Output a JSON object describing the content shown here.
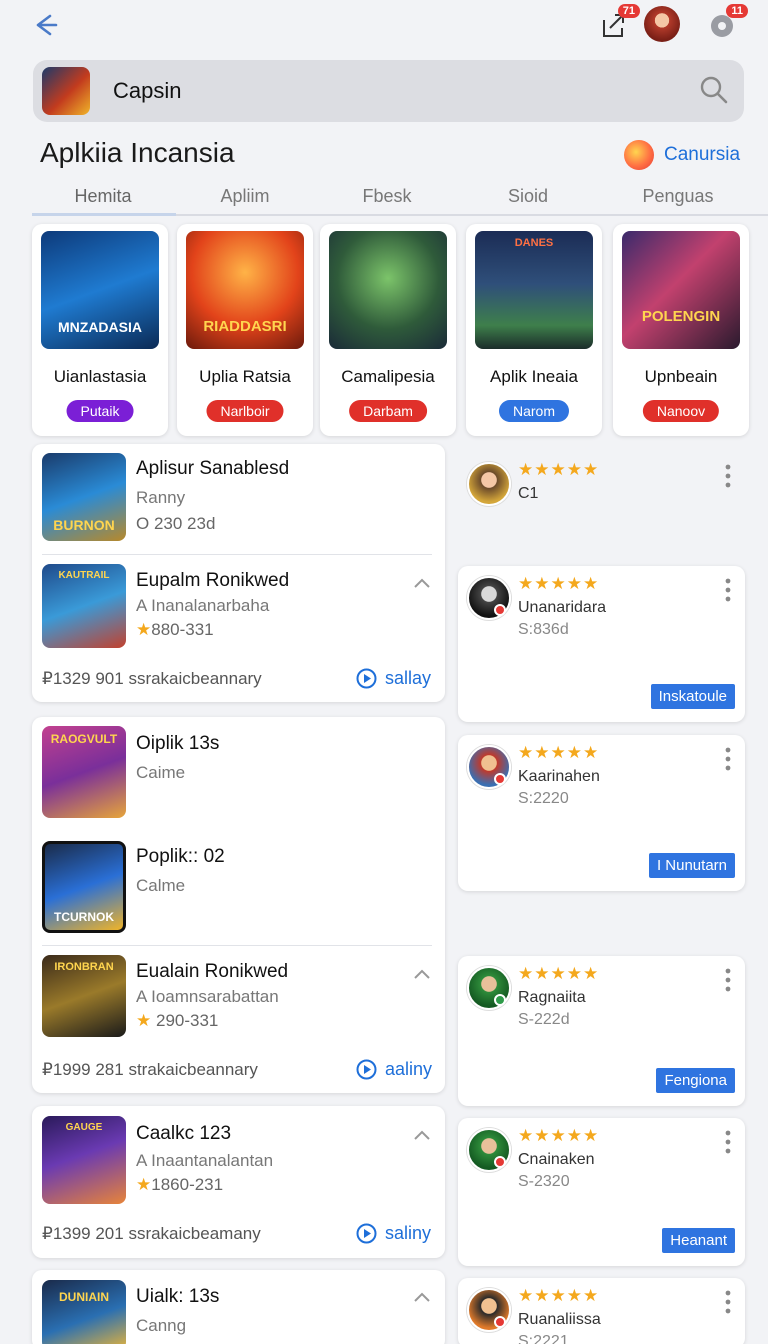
{
  "header": {
    "notification_badge": "71",
    "profile_badge": "11"
  },
  "search": {
    "query": "Capsin"
  },
  "section": {
    "title": "Aplkiia Incansia",
    "link_label": "Canursia"
  },
  "tabs": [
    "Hemita",
    "Apliim",
    "Fbesk",
    "Sioid",
    "Penguas"
  ],
  "featured": [
    {
      "name": "Uianlastasia",
      "tag": "Putaik",
      "tag_color": "#7b1fd6",
      "art_text": "MNZADASIA"
    },
    {
      "name": "Uplia Ratsia",
      "tag": "Narlboir",
      "tag_color": "#e0302a",
      "art_text": "RIADDASRI"
    },
    {
      "name": "Camalipesia",
      "tag": "Darbam",
      "tag_color": "#e0302a",
      "art_text": ""
    },
    {
      "name": "Aplik Ineaia",
      "tag": "Narom",
      "tag_color": "#2f74e0",
      "art_text": "DANES"
    },
    {
      "name": "Upnbeain",
      "tag": "Nanoov",
      "tag_color": "#e0302a",
      "art_text": "POLENGIN"
    }
  ],
  "list_cards": [
    {
      "items": [
        {
          "title": "Aplisur Sanablesd",
          "sub": "Ranny",
          "meta": "O 230 23d",
          "art": "BURNON"
        },
        {
          "title": "Eupalm Ronikwed",
          "sub": "A Inanalanarbaha",
          "meta": "880-331",
          "art": "KAUTRAIL"
        }
      ],
      "footer": "₽1329 901 ssrakaicbeannary",
      "action": "sallay"
    },
    {
      "items": [
        {
          "title": "Oiplik 13s",
          "sub": "Caime",
          "meta": "",
          "art": "RAOGVULT"
        },
        {
          "title": "Poplik:: 02",
          "sub": "Calme",
          "meta": "",
          "art": "TCURNOK"
        },
        {
          "title": "Eualain Ronikwed",
          "sub": "A Ioamnsarabattan",
          "meta": "290-331",
          "art": "IRONBRAN"
        }
      ],
      "footer": "₽1999 281 strakaicbeannary",
      "action": "aaliny"
    },
    {
      "items": [
        {
          "title": "Caalkc 123",
          "sub": "A Inaantanalantan",
          "meta": "1860-231",
          "art": "GAUGE"
        }
      ],
      "footer": "₽1399 201 ssrakaicbeamany",
      "action": "saliny"
    },
    {
      "items": [
        {
          "title": "Uialk: 13s",
          "sub": "Canng",
          "meta": "",
          "art": "DUNIAIN"
        }
      ],
      "footer": "",
      "action": ""
    }
  ],
  "reviews": [
    {
      "stars": "★★★★★",
      "name": "C1",
      "code": "",
      "button": ""
    },
    {
      "stars": "★★★★★",
      "name": "Unanaridara",
      "code": "S:836d",
      "button": "Inskatoule"
    },
    {
      "stars": "★★★★★",
      "name": "Kaarinahen",
      "code": "S:2220",
      "button": "I Nunutarn"
    },
    {
      "stars": "★★★★★",
      "name": "Ragnaiita",
      "code": "S-222d",
      "button": "Fengiona"
    },
    {
      "stars": "★★★★★",
      "name": "Cnainaken",
      "code": "S-2320",
      "button": "Heanant"
    },
    {
      "stars": "★★★★★",
      "name": "Ruanaliissa",
      "code": "S:2221",
      "button": ""
    }
  ],
  "colors": {
    "accent": "#1e6fd9",
    "button_blue": "#2f74e0",
    "star": "#f4a81d",
    "badge_red": "#e53935"
  }
}
